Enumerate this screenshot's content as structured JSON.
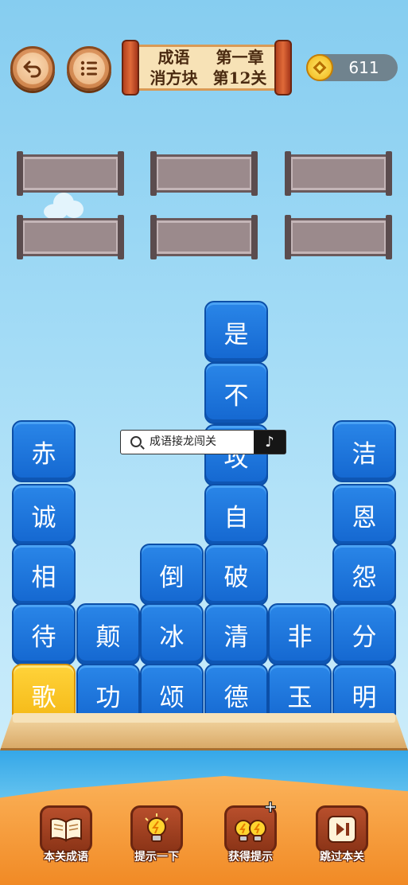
{
  "header": {
    "title_line1_left": "成语",
    "title_line1_right": "第一章",
    "title_line2_left": "消方块",
    "title_line2_right": "第12关",
    "coins": "611"
  },
  "answer_slots": 6,
  "board": {
    "columns": [
      [
        "赤",
        "诚",
        "相",
        "待",
        "歌"
      ],
      [
        "颠",
        "功"
      ],
      [
        "倒",
        "冰",
        "颂"
      ],
      [
        "是",
        "不",
        "攻",
        "自",
        "破",
        "清",
        "德"
      ],
      [
        "非",
        "玉"
      ],
      [
        "洁",
        "恩",
        "怨",
        "分",
        "明"
      ]
    ],
    "highlighted": "歌"
  },
  "search_overlay": {
    "text": "成语接龙闯关",
    "app_glyph": "♪"
  },
  "toolbar": {
    "btn1": "本关成语",
    "btn2": "提示一下",
    "btn3": "获得提示",
    "btn4": "跳过本关"
  },
  "colors": {
    "tile_blue": "#1a72dc",
    "tile_gold": "#f8c11f",
    "sky": "#94d4f4",
    "sand": "#f39a36"
  },
  "icons": [
    "back-arrow-icon",
    "menu-list-icon",
    "coin-icon",
    "book-icon",
    "lightbulb-icon",
    "double-lightbulb-icon",
    "skip-icon",
    "search-icon"
  ]
}
